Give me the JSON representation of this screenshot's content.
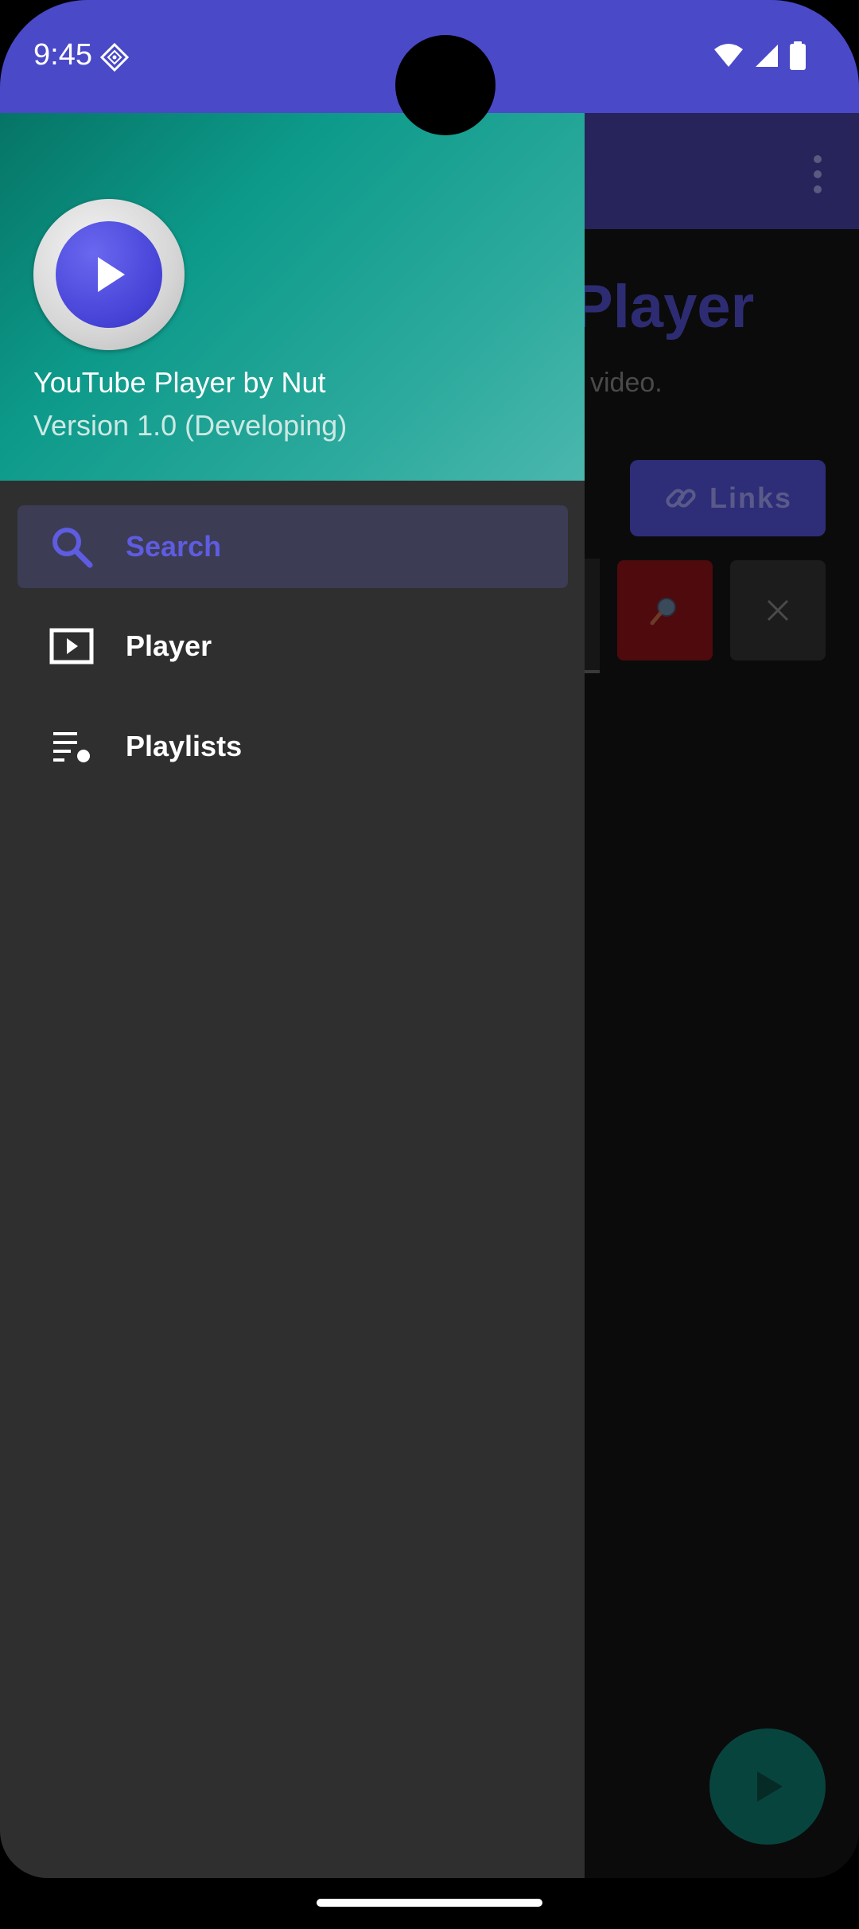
{
  "status_bar": {
    "time": "9:45"
  },
  "background": {
    "title_fragment": "Player",
    "subtitle_fragment": "video.",
    "links_button": "Links"
  },
  "drawer": {
    "app_name": "YouTube Player by Nut",
    "version": "Version 1.0 (Developing)",
    "items": [
      {
        "label": "Search",
        "icon": "search-icon",
        "active": true
      },
      {
        "label": "Player",
        "icon": "video-player-icon",
        "active": false
      },
      {
        "label": "Playlists",
        "icon": "playlist-icon",
        "active": false
      }
    ]
  },
  "colors": {
    "status_bar": "#4a49c8",
    "drawer_bg": "#2f2f2f",
    "accent": "#5e5ce0",
    "header_teal": "#0d9a8a"
  }
}
